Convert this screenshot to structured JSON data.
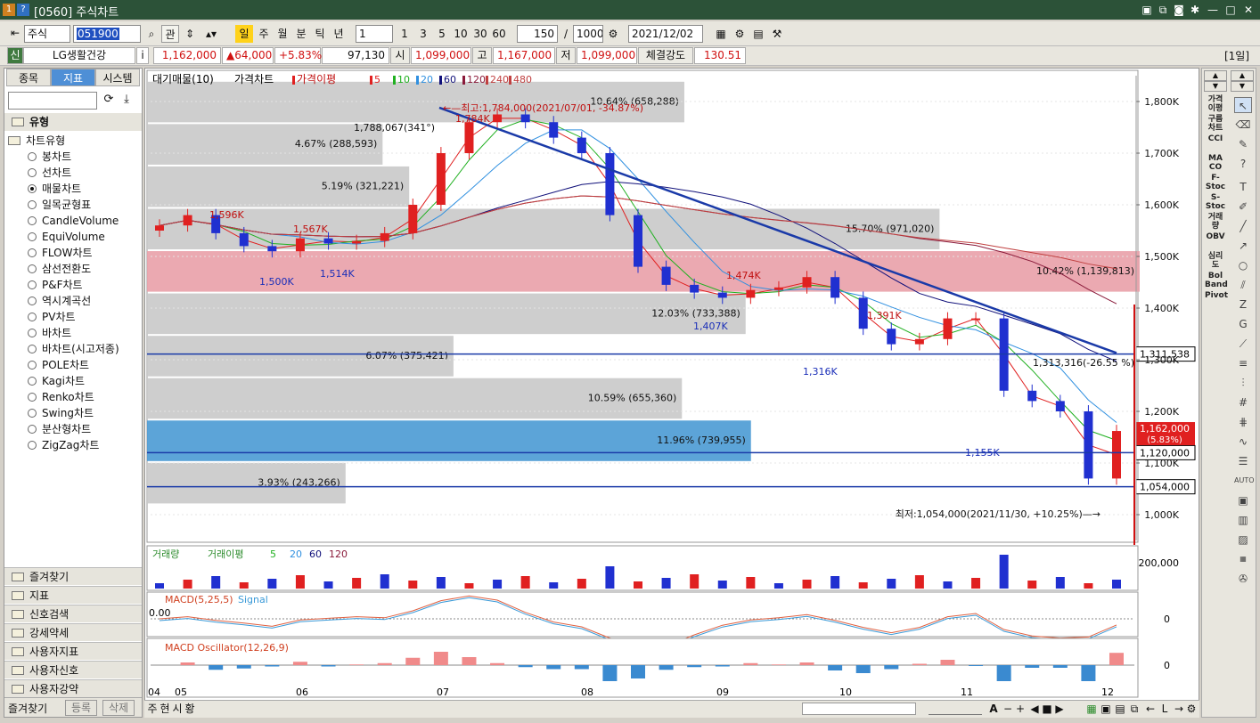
{
  "window": {
    "title": "[0560] 주식차트",
    "badge1": "1",
    "badge2": "?"
  },
  "toolbar": {
    "market": "주식",
    "code": "051900",
    "btn_gwan": "관",
    "periods": [
      "일",
      "주",
      "월",
      "분",
      "틱",
      "년"
    ],
    "period_active": "일",
    "interval": "1",
    "quick": [
      "1",
      "3",
      "5",
      "10",
      "30",
      "60"
    ],
    "count": "150",
    "slash": "/",
    "total": "1000",
    "date": "2021/12/02"
  },
  "quote": {
    "flag": "신",
    "name": "LG생활건강",
    "info": "i",
    "price": "1,162,000",
    "change": "▲64,000",
    "change_pct": "+5.83%",
    "volume": "97,130",
    "open_label": "시",
    "open": "1,099,000",
    "high_label": "고",
    "high": "1,167,000",
    "low_label": "저",
    "low": "1,099,000",
    "strength_label": "체결강도",
    "strength": "130.51",
    "unit": "[1일]"
  },
  "left": {
    "tabs": [
      "종목",
      "지표",
      "시스템"
    ],
    "active_tab": "지표",
    "tree_title": "유형",
    "tree_group": "차트유형",
    "items": [
      "봉차트",
      "선차트",
      "매물차트",
      "일목균형표",
      "CandleVolume",
      "EquiVolume",
      "FLOW차트",
      "삼선전환도",
      "P&F차트",
      "역시계곡선",
      "PV차트",
      "바차트",
      "바차트(시고저종)",
      "POLE차트",
      "Kagi차트",
      "Renko차트",
      "Swing차트",
      "분산형차트",
      "ZigZag차트"
    ],
    "selected": "매물차트",
    "categories": [
      "즐겨찾기",
      "지표",
      "신호검색",
      "강세약세",
      "사용자지표",
      "사용자신호",
      "사용자강약"
    ],
    "footer": [
      "즐겨찾기",
      "등록",
      "삭제"
    ]
  },
  "chart": {
    "legend": {
      "main": "대기매물(10)",
      "price": "가격차트",
      "ma_label": "가격이평",
      "ma": [
        "5",
        "10",
        "20",
        "60",
        "120",
        "240",
        "480"
      ]
    },
    "colors": {
      "up": "#e02020",
      "down": "#2030d0",
      "ma5": "#e02020",
      "ma10": "#20b020",
      "ma20": "#3090e0",
      "ma60": "#10107a",
      "ma120": "#8a1a3a",
      "ma240": "#c04040",
      "ma480": "#c04040",
      "trend": "#1a3aa8",
      "bar_gray": "#c9c9c9",
      "bar_pink": "#e9a0a8",
      "bar_blue": "#4a9ad4"
    },
    "y_ticks": [
      "1,800K",
      "1,700K",
      "1,600K",
      "1,500K",
      "1,400K",
      "1,300K",
      "1,200K",
      "1,100K",
      "1,000K"
    ],
    "y_values": [
      1800,
      1700,
      1600,
      1500,
      1400,
      1300,
      1200,
      1100,
      1000
    ],
    "x_labels": [
      "04",
      "05",
      "06",
      "07",
      "08",
      "09",
      "10",
      "11",
      "12"
    ],
    "volume_profile": [
      {
        "label": "10.64% (658,288)",
        "value": 658288
      },
      {
        "label": "4.67% (288,593)",
        "value": 288593
      },
      {
        "label": "5.19% (321,221)",
        "value": 321221
      },
      {
        "label": "15.70% (971,020)",
        "value": 971020
      },
      {
        "label": "10.42% (1,139,813)",
        "value": 1139813
      },
      {
        "label": "12.03% (733,388)",
        "value": 733388
      },
      {
        "label": "6.07% (375,421)",
        "value": 375421
      },
      {
        "label": "10.59% (655,360)",
        "value": 655360
      },
      {
        "label": "11.96% (739,955)",
        "value": 739955
      },
      {
        "label": "3.93% (243,266)",
        "value": 243266
      }
    ],
    "annotations": {
      "max": "←—최고:1,784,000(2021/07/01, -34.87%)",
      "min": "최저:1,054,000(2021/11/30, +10.25%)—→",
      "trend_start": "1,788,067(341°)",
      "trend_end": "1,313,316(-26.55 %)"
    },
    "peaks": [
      "1,596K",
      "1,567K",
      "1,500K",
      "1,514K",
      "1,784K",
      "1,474K",
      "1,407K",
      "1,316K",
      "1,391K",
      "1,155K"
    ],
    "price_tags": {
      "last": "1,162,000",
      "last_pct": "(5.83%)",
      "h1": "1,311,538",
      "h2": "1,120,000",
      "h3": "1,054,000"
    },
    "volume_legend": {
      "vol": "거래량",
      "ma_label": "거래이평",
      "ma": [
        "5",
        "20",
        "60",
        "120"
      ]
    },
    "volume_tick": "200,000",
    "macd_legend": {
      "label": "MACD(5,25,5)",
      "signal": "Signal"
    },
    "macd_tick": "0",
    "macd_zero": "0.00",
    "osc_legend": "MACD Oscillator(12,26,9)",
    "osc_tick": "0"
  },
  "chart_data": {
    "type": "candlestick",
    "dates": [
      "04-01",
      "04-09",
      "04-19",
      "04-26",
      "05-03",
      "05-11",
      "05-18",
      "05-25",
      "06-01",
      "06-08",
      "06-15",
      "06-22",
      "06-29",
      "07-06",
      "07-13",
      "07-20",
      "07-27",
      "08-03",
      "08-10",
      "08-17",
      "08-24",
      "08-31",
      "09-07",
      "09-14",
      "09-24",
      "10-01",
      "10-08",
      "10-15",
      "10-22",
      "10-29",
      "11-05",
      "11-12",
      "11-19",
      "11-26",
      "12-02"
    ],
    "close": [
      1560,
      1580,
      1545,
      1520,
      1510,
      1535,
      1525,
      1530,
      1545,
      1600,
      1700,
      1760,
      1775,
      1760,
      1730,
      1700,
      1580,
      1480,
      1445,
      1430,
      1420,
      1435,
      1440,
      1460,
      1420,
      1360,
      1330,
      1340,
      1380,
      1380,
      1240,
      1220,
      1200,
      1070,
      1162
    ],
    "ylim": [
      950,
      1850
    ],
    "ylabel": "",
    "xlabel": ""
  },
  "rightbar": {
    "items": [
      "가격\n이평",
      "구름\n차트",
      "CCI",
      "MA\nCO",
      "F-\nStoc",
      "S-\nStoc",
      "거래\n량",
      "OBV",
      "심리\n도",
      "Bol\nBand",
      "Pivot"
    ]
  },
  "bottombar": {
    "tabs": [
      "주",
      "현",
      "시",
      "황"
    ]
  }
}
